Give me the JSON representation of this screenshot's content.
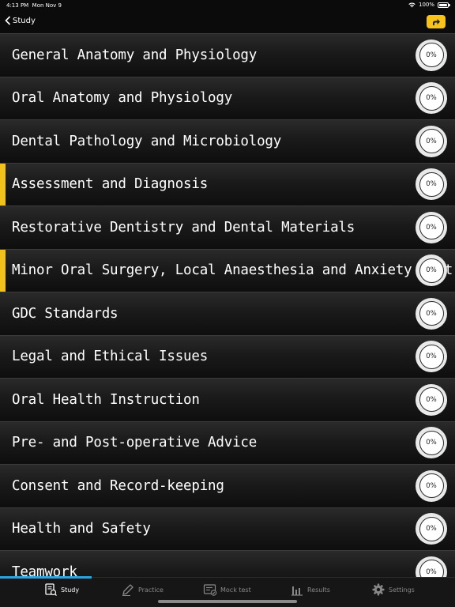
{
  "status_bar": {
    "time": "4:13 PM",
    "date": "Mon Nov 9",
    "battery": "100%"
  },
  "nav": {
    "back_label": "Study"
  },
  "topics": [
    {
      "label": "General Anatomy and Physiology",
      "progress": "0%",
      "highlight": false
    },
    {
      "label": "Oral Anatomy and Physiology",
      "progress": "0%",
      "highlight": false
    },
    {
      "label": "Dental Pathology and Microbiology",
      "progress": "0%",
      "highlight": false
    },
    {
      "label": "Assessment and Diagnosis",
      "progress": "0%",
      "highlight": true
    },
    {
      "label": "Restorative Dentistry and Dental Materials",
      "progress": "0%",
      "highlight": false
    },
    {
      "label": "Minor Oral Surgery, Local Anaesthesia and Anxiety Control",
      "progress": "0%",
      "highlight": true
    },
    {
      "label": "GDC Standards",
      "progress": "0%",
      "highlight": false
    },
    {
      "label": "Legal and Ethical Issues",
      "progress": "0%",
      "highlight": false
    },
    {
      "label": "Oral Health Instruction",
      "progress": "0%",
      "highlight": false
    },
    {
      "label": "Pre- and Post-operative Advice",
      "progress": "0%",
      "highlight": false
    },
    {
      "label": "Consent and Record-keeping",
      "progress": "0%",
      "highlight": false
    },
    {
      "label": "Health and Safety",
      "progress": "0%",
      "highlight": false
    },
    {
      "label": "Teamwork",
      "progress": "0%",
      "highlight": false
    }
  ],
  "tabs": [
    {
      "label": "Study",
      "icon": "study-icon",
      "active": true
    },
    {
      "label": "Practice",
      "icon": "pencil-icon",
      "active": false
    },
    {
      "label": "Mock test",
      "icon": "mock-test-icon",
      "active": false
    },
    {
      "label": "Results",
      "icon": "bar-chart-icon",
      "active": false
    },
    {
      "label": "Settings",
      "icon": "gear-icon",
      "active": false
    }
  ],
  "colors": {
    "accent_yellow": "#f2c21b",
    "tab_indicator": "#2ba4e0"
  }
}
